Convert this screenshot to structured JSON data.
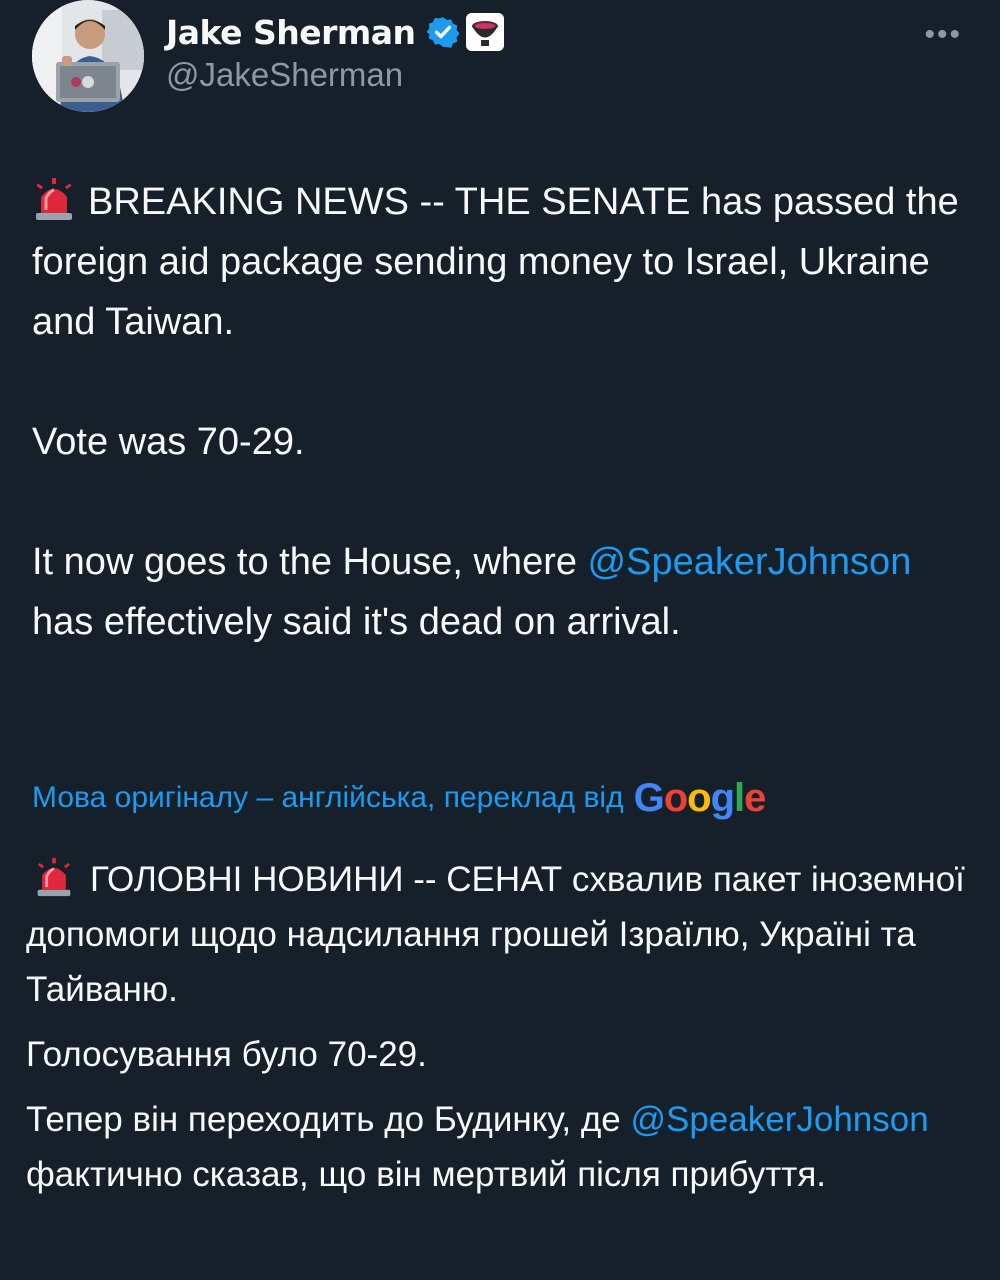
{
  "author": {
    "display_name": "Jake Sherman",
    "handle": "@JakeSherman",
    "verified": true,
    "affiliate_badge": "politico-playbook-badge"
  },
  "menu": {
    "more_label": "•••"
  },
  "tweet": {
    "line1_text": "BREAKING NEWS -- THE SENATE has passed the foreign aid package sending money to Israel, Ukraine and Taiwan.",
    "line2_text": "Vote was 70-29.",
    "line3_prefix": "It now goes to the House, where ",
    "line3_mention": "@SpeakerJohnson",
    "line3_suffix": " has effectively said it's dead on arrival."
  },
  "translation": {
    "notice": "Мова оригіналу – англійська, переклад від",
    "provider": [
      "G",
      "o",
      "o",
      "g",
      "l",
      "e"
    ],
    "para1_text": "ГОЛОВНІ НОВИНИ -- СЕНАТ схвалив пакет іноземної допомоги щодо надсилання грошей Ізраїлю, Україні та Тайваню.",
    "para2_text": "Голосування було 70-29.",
    "para3_prefix": "Тепер він переходить до Будинку, де ",
    "para3_mention": "@SpeakerJohnson",
    "para3_suffix": " фактично сказав, що він мертвий після прибуття."
  },
  "colors": {
    "background": "#15202b",
    "text": "#f7f9f9",
    "secondary": "#8b98a5",
    "accent": "#1d9bf0",
    "siren": "#e0283c"
  },
  "icons": {
    "siren": "police-car-light-icon",
    "verified": "verified-badge-icon",
    "more": "more-horizontal-icon"
  }
}
